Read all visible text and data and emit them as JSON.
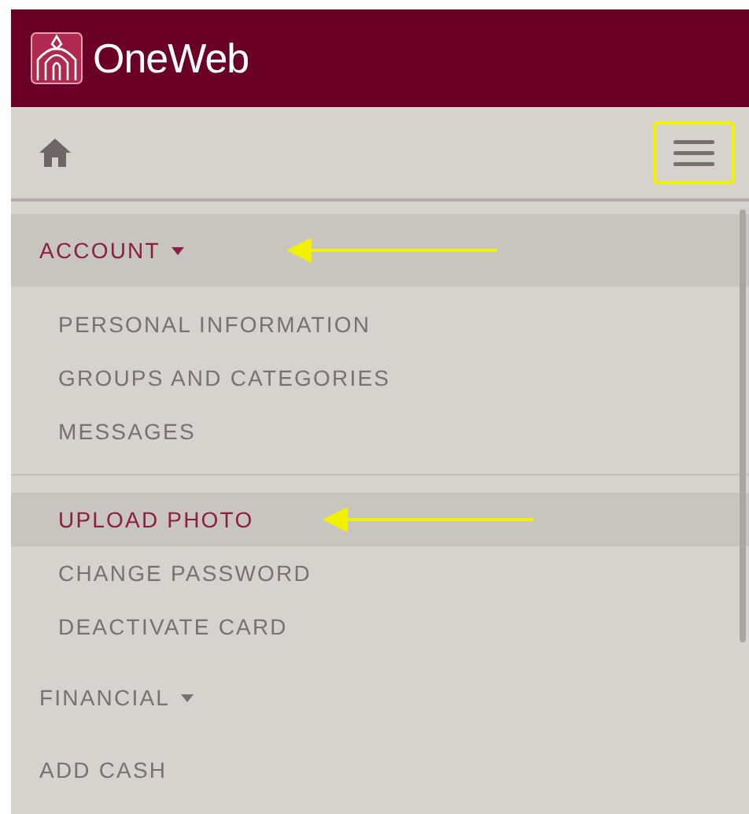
{
  "header": {
    "logo_text": "OneWeb"
  },
  "toolbar": {
    "menu_button": {
      "highlighted": true
    }
  },
  "menu": [
    {
      "kind": "section",
      "label": "ACCOUNT",
      "selected": true,
      "annotated": true,
      "children": [
        {
          "label": "PERSONAL INFORMATION",
          "selected": false,
          "annotated": false,
          "divider_before": false
        },
        {
          "label": "GROUPS AND CATEGORIES",
          "selected": false,
          "annotated": false,
          "divider_before": false
        },
        {
          "label": "MESSAGES",
          "selected": false,
          "annotated": false,
          "divider_before": false
        },
        {
          "label": "UPLOAD PHOTO",
          "selected": true,
          "annotated": true,
          "divider_before": true
        },
        {
          "label": "CHANGE PASSWORD",
          "selected": false,
          "annotated": false,
          "divider_before": false
        },
        {
          "label": "DEACTIVATE CARD",
          "selected": false,
          "annotated": false,
          "divider_before": false
        }
      ]
    },
    {
      "kind": "section",
      "label": "FINANCIAL",
      "selected": false,
      "annotated": false
    },
    {
      "kind": "link",
      "label": "ADD CASH",
      "selected": false,
      "annotated": false
    }
  ]
}
